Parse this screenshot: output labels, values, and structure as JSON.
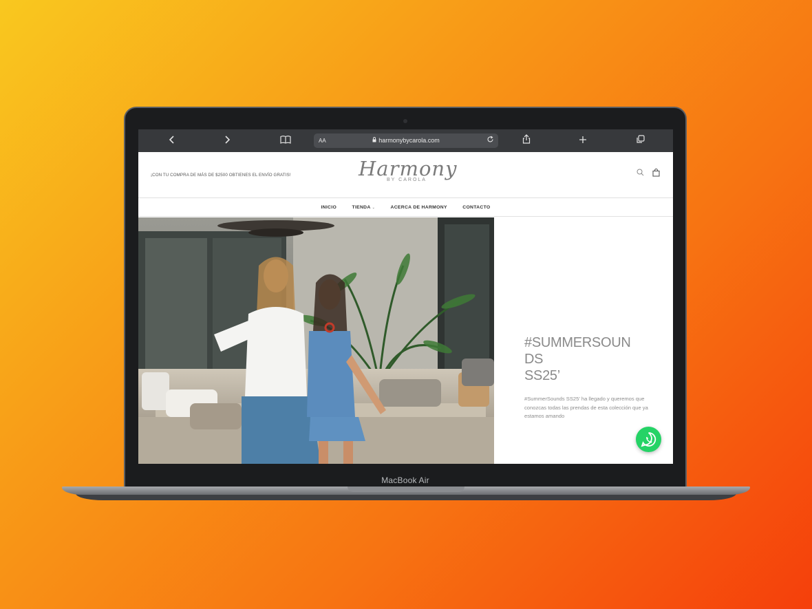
{
  "laptop": {
    "model_label": "MacBook Air"
  },
  "browser": {
    "url": "harmonybycarola.com",
    "text_size_label": "AA",
    "icons": [
      "chevron-left-icon",
      "chevron-right-icon",
      "book-icon",
      "lock-icon",
      "reload-icon",
      "share-icon",
      "plus-icon",
      "tabs-icon"
    ]
  },
  "site": {
    "promo": "¡CON TU COMPRA DE MÁS DE $2500 OBTIENES EL ENVÍO GRATIS!",
    "logo_main": "Harmony",
    "logo_sub": "BY CAROLA",
    "nav": [
      "INICIO",
      "TIENDA",
      "ACERCA DE HARMONY",
      "CONTACTO"
    ],
    "hero": {
      "title_line1": "#SUMMERSOUN",
      "title_line2": "DS",
      "title_line3": "SS25’",
      "description": "#SummerSounds SS25’ ha llegado y queremos que conozcas todas las prendas de esta colección que ya estamos amando"
    }
  },
  "colors": {
    "background_start": "#f9c81f",
    "background_end": "#f53f0b",
    "whatsapp": "#25d366"
  }
}
